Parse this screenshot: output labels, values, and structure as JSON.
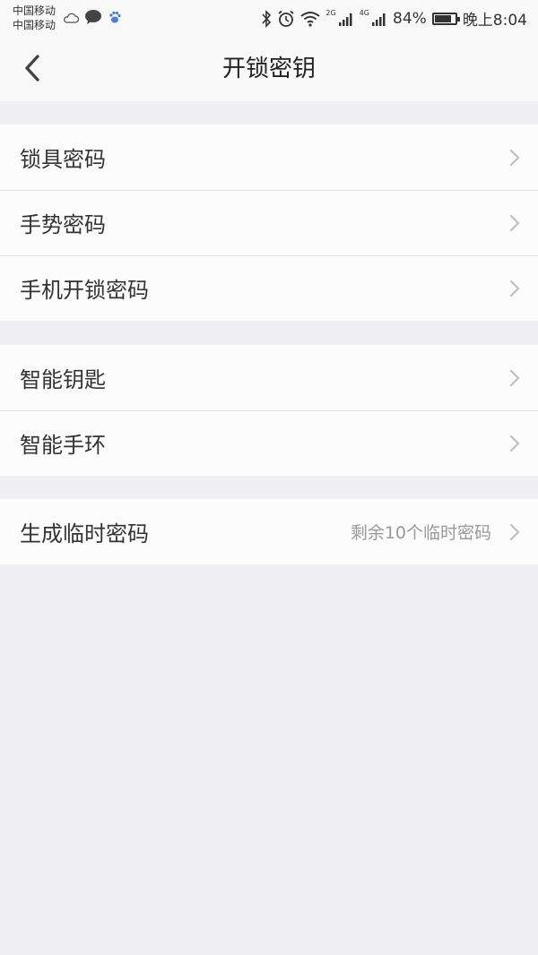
{
  "status_bar": {
    "carrier_1": "中国移动",
    "carrier_2": "中国移动",
    "net_1": "2G",
    "net_2": "4G",
    "battery_text": "84%",
    "battery_level": 0.84,
    "time": "晚上8:04",
    "icons": [
      "cloud-icon",
      "chat-bubble-icon",
      "paw-icon",
      "bluetooth-icon",
      "alarm-icon",
      "wifi-icon",
      "signal-icon",
      "signal-icon",
      "battery-icon"
    ]
  },
  "nav": {
    "title": "开锁密钥",
    "back_icon": "chevron-left-icon"
  },
  "groups": [
    {
      "items": [
        {
          "label": "锁具密码"
        },
        {
          "label": "手势密码"
        },
        {
          "label": "手机开锁密码"
        }
      ]
    },
    {
      "items": [
        {
          "label": "智能钥匙"
        },
        {
          "label": "智能手环"
        }
      ]
    },
    {
      "items": [
        {
          "label": "生成临时密码",
          "detail": "剩余10个临时密码"
        }
      ]
    }
  ],
  "colors": {
    "background": "#efeff4",
    "row_background": "#fcfcfc",
    "text": "#333333",
    "detail_text": "#999999",
    "chevron": "#c4c4c8",
    "divider": "#e2e2e6"
  }
}
